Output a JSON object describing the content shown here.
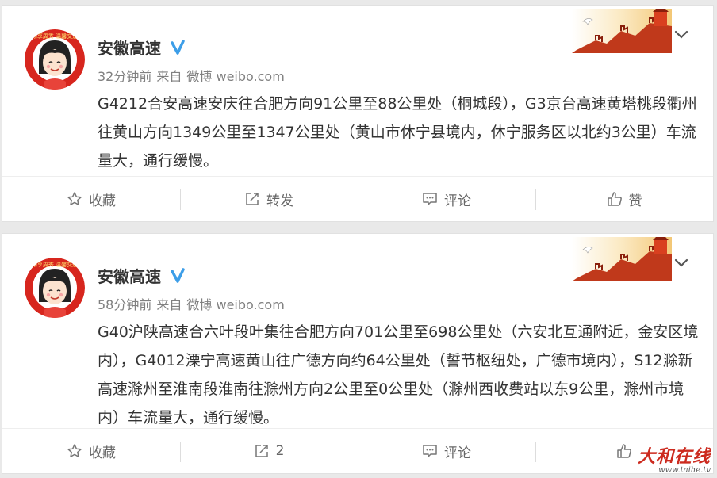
{
  "posts": [
    {
      "author": "安徽高速",
      "meta": {
        "time": "32分钟前",
        "source_prefix": "来自",
        "source": "微博 weibo.com"
      },
      "text": "G4212合安高速安庆往合肥方向91公里至88公里处（桐城段），G3京台高速黄塔桃段衢州往黄山方向1349公里至1347公里处（黄山市休宁县境内，休宁服务区以北约3公里）车流量大，通行缓慢。",
      "actions": {
        "favorite": "收藏",
        "repost": "转发",
        "comment": "评论",
        "like": "赞"
      }
    },
    {
      "author": "安徽高速",
      "meta": {
        "time": "58分钟前",
        "source_prefix": "来自",
        "source": "微博 weibo.com"
      },
      "text": "G40沪陕高速合六叶段叶集往合肥方向701公里至698公里处（六安北互通附近，金安区境内），G4012溧宁高速黄山往广德方向约64公里处（誓节枢纽处，广德市境内），S12滁新高速滁州至淮南段淮南往滁州方向2公里至0公里处（滁州西收费站以东9公里，滁州市境内）车流量大，通行缓慢。",
      "actions": {
        "favorite": "收藏",
        "repost": "2",
        "comment": "评论",
        "like": "赞"
      }
    }
  ],
  "avatar_text": "畅享周秀 温馨交通",
  "watermark": {
    "main": "大和在线",
    "url": "www.taihe.tv"
  },
  "colors": {
    "avatar_red": "#d7261e",
    "verified_blue": "#3d9ee8",
    "wall_red": "#c0391b"
  }
}
